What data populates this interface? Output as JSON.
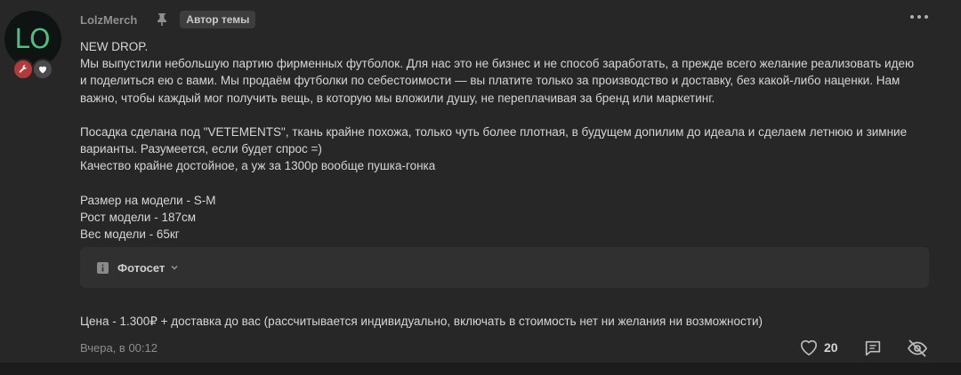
{
  "post": {
    "avatar_text": "LO",
    "username": "LolzMerch",
    "author_tag": "Автор темы",
    "paragraphs": [
      "NEW DROP.",
      "Мы выпустили небольшую партию фирменных футболок. Для нас это не бизнес и не способ заработать, а прежде всего желание реализовать идею",
      "и поделиться ею с вами. Мы продаём футболки по себестоимости — вы платите только за производство и доставку, без какой-либо наценки. Нам",
      "важно, чтобы каждый мог получить вещь, в которую мы вложили душу, не переплачивая за бренд или маркетинг.",
      "Посадка сделана под \"VETEMENTS\", ткань крайне похожа, только чуть более плотная, в будущем допилим до идеала и сделаем летнюю и зимние",
      "варианты. Разумеется, если будет спрос =)",
      "Качество крайне достойное, а уж за 1300р вообще пушка-гонка",
      "Размер на модели - S-M",
      "Рост модели - 187см",
      "Вес модели - 65кг"
    ],
    "spoiler_label": "Фотосет",
    "price_line": "Цена - 1.300₽ + доставка до вас (рассчитывается индивидуально, включать в стоимость нет ни желания ни возможности)",
    "timestamp": "Вчера, в 00:12",
    "like_count": "20"
  },
  "icons": {
    "badge_tool": "wrench-icon",
    "badge_heart": "heart-icon",
    "pin": "pin-icon",
    "more": "more-dots-icon",
    "info": "info-icon",
    "chevron": "chevron-down-icon",
    "like": "heart-outline-icon",
    "reply": "comment-icon",
    "hide": "eye-off-icon"
  },
  "colors": {
    "background": "#272727",
    "avatar_text": "#4fbf83",
    "badge_tool": "#b23a3a",
    "text": "#d6d6d6",
    "muted": "#8c8c8c"
  }
}
